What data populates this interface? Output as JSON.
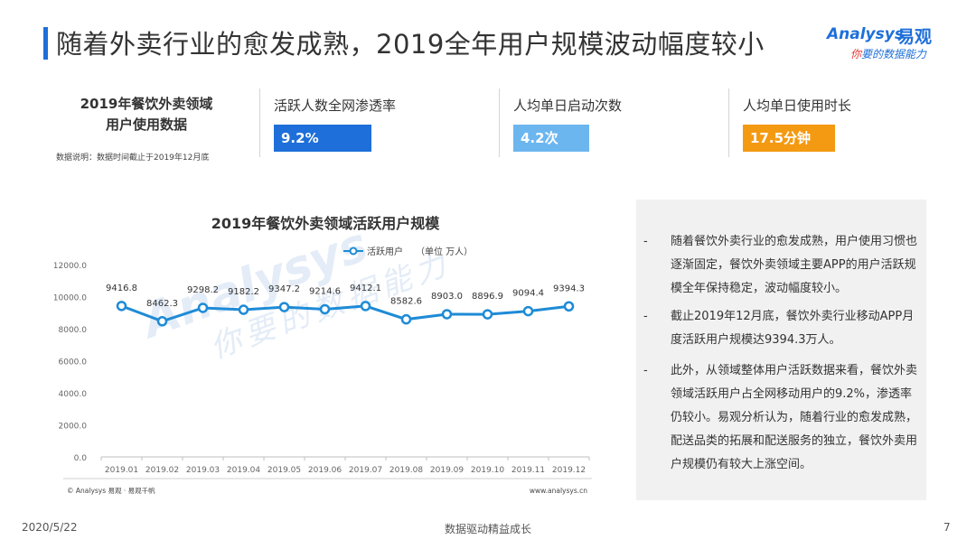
{
  "header": {
    "title": "随着外卖行业的愈发成熟，2019全年用户规模波动幅度较小",
    "logo_en": "Analysys",
    "logo_cn": "易观",
    "logo_tagline_first": "你",
    "logo_tagline_rest": "要的数据能力"
  },
  "summary": {
    "title_line1": "2019年餐饮外卖领域",
    "title_line2": "用户使用数据",
    "note": "数据说明：数据时间截止于2019年12月底"
  },
  "metrics": [
    {
      "label": "活跃人数全网渗透率",
      "value": "9.2%",
      "color": "#1e6fd9",
      "fill": 0.92
    },
    {
      "label": "人均单日启动次数",
      "value": "4.2次",
      "color": "#6cb6f0",
      "fill": 0.68
    },
    {
      "label": "人均单日使用时长",
      "value": "17.5分钟",
      "color": "#f49a12",
      "fill": 0.86
    }
  ],
  "chart_data": {
    "type": "line",
    "title": "2019年餐饮外卖领域活跃用户规模",
    "legend": "活跃用户",
    "unit": "（单位 万人）",
    "legend_position": "top-center",
    "categories": [
      "2019.01",
      "2019.02",
      "2019.03",
      "2019.04",
      "2019.05",
      "2019.06",
      "2019.07",
      "2019.08",
      "2019.09",
      "2019.10",
      "2019.11",
      "2019.12"
    ],
    "series": [
      {
        "name": "活跃用户",
        "values": [
          9416.8,
          8462.3,
          9298.2,
          9182.2,
          9347.2,
          9214.6,
          9412.1,
          8582.6,
          8903.0,
          8896.9,
          9094.4,
          9394.3
        ]
      }
    ],
    "value_labels": [
      "9416.8",
      "8462.3",
      "9298.2",
      "9182.2",
      "9347.2",
      "9214.6",
      "9412.1",
      "8582.6",
      "8903.0",
      "8896.9",
      "9094.4",
      "9394.3"
    ],
    "ylim": [
      0,
      12000
    ],
    "yticks": [
      "0.0",
      "2000.0",
      "4000.0",
      "6000.0",
      "8000.0",
      "10000.0",
      "12000.0"
    ],
    "grid": false,
    "color": "#1e8bd6",
    "source_left": "© Analysys 易观 · 易观千帆",
    "source_right": "www.analysys.cn"
  },
  "panel": {
    "dash": "-",
    "items": [
      "随着餐饮外卖行业的愈发成熟，用户使用习惯也逐渐固定，餐饮外卖领域主要APP的用户活跃规模全年保持稳定，波动幅度较小。",
      "截止2019年12月底，餐饮外卖行业移动APP月度活跃用户规模达9394.3万人。",
      "此外，从领域整体用户活跃数据来看，餐饮外卖领域活跃用户占全网移动用户的9.2%，渗透率仍较小。易观分析认为，随着行业的愈发成熟，配送品类的拓展和配送服务的独立，餐饮外卖用户规模仍有较大上涨空间。"
    ]
  },
  "footer": {
    "date": "2020/5/22",
    "slogan": "数据驱动精益成长",
    "page": "7"
  }
}
